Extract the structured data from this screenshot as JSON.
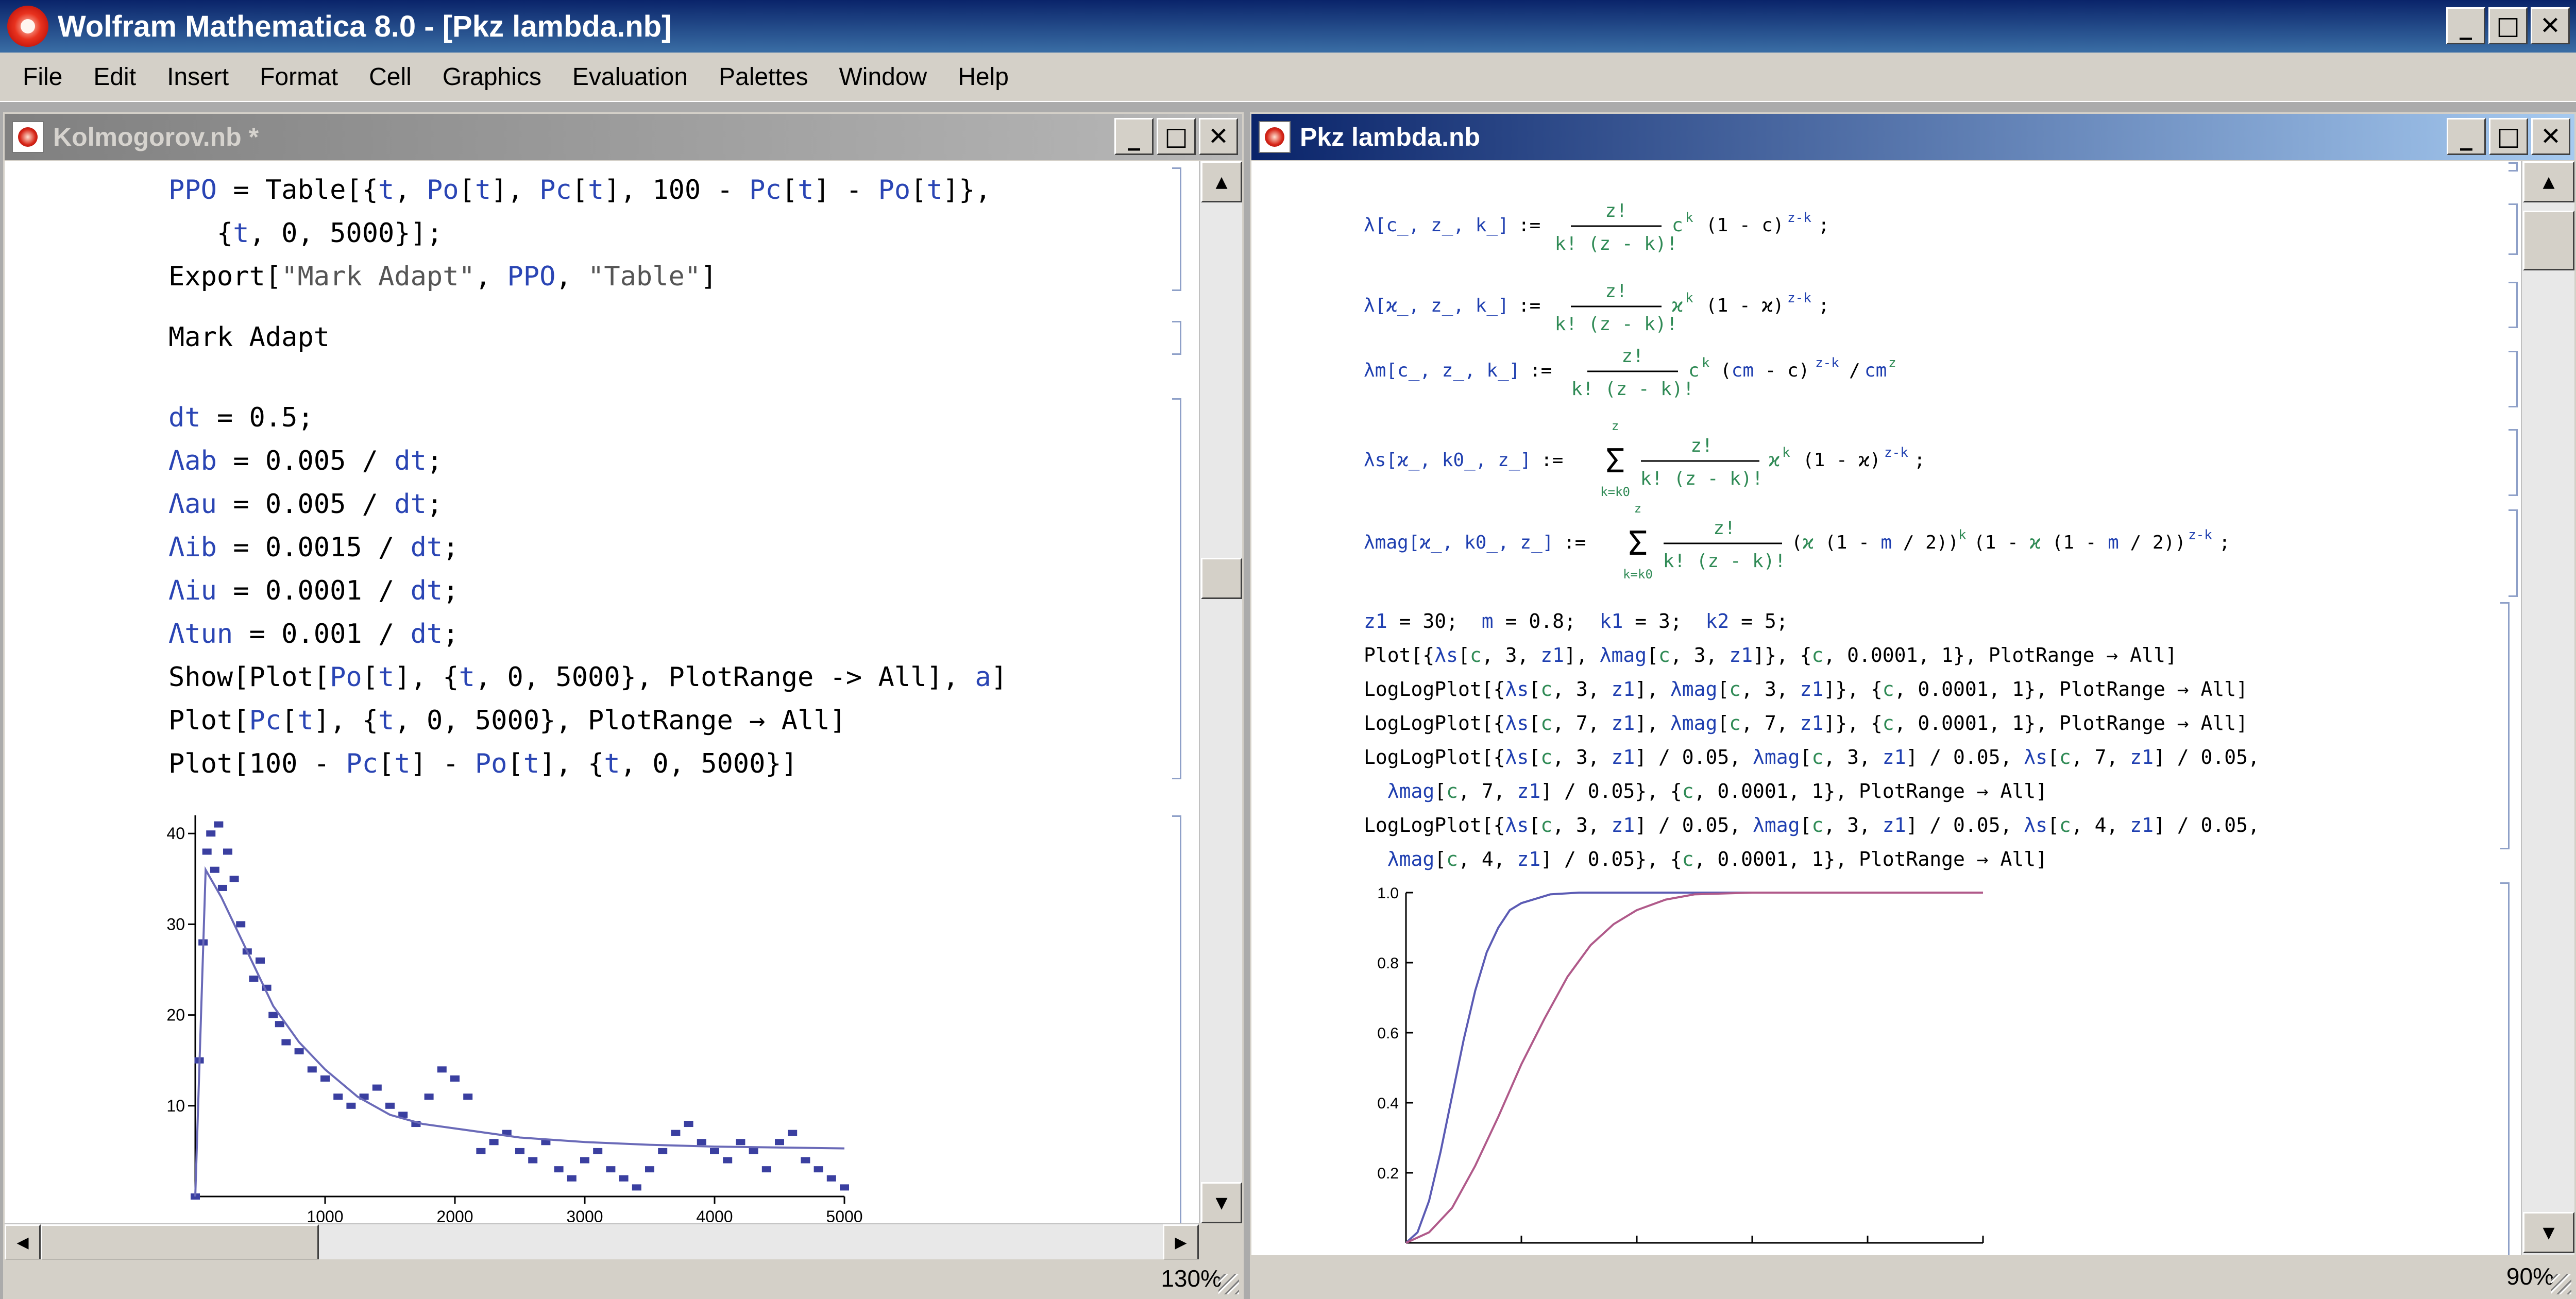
{
  "app": {
    "title": "Wolfram Mathematica 8.0 - [Pkz lambda.nb]",
    "controls": {
      "minimize": "_",
      "maximize": "□",
      "close": "✕"
    }
  },
  "menu": [
    "File",
    "Edit",
    "Insert",
    "Format",
    "Cell",
    "Graphics",
    "Evaluation",
    "Palettes",
    "Window",
    "Help"
  ],
  "left_window": {
    "title": "Kolmogorov.nb *",
    "zoom": "130%",
    "output_text": "Mark Adapt"
  },
  "right_window": {
    "title": "Pkz lambda.nb",
    "zoom": "90%"
  },
  "chart_data": [
    {
      "type": "scatter",
      "title": "",
      "xlabel": "",
      "ylabel": "",
      "xlim": [
        0,
        5000
      ],
      "ylim": [
        0,
        42
      ],
      "xticks": [
        "1000",
        "2000",
        "3000",
        "4000",
        "5000"
      ],
      "yticks": [
        "10",
        "20",
        "30",
        "40"
      ],
      "grid": false,
      "series": [
        {
          "values": [
            [
              0,
              0
            ],
            [
              30,
              15
            ],
            [
              60,
              28
            ],
            [
              90,
              38
            ],
            [
              120,
              40
            ],
            [
              150,
              36
            ],
            [
              180,
              41
            ],
            [
              210,
              34
            ],
            [
              250,
              38
            ],
            [
              300,
              35
            ],
            [
              350,
              30
            ],
            [
              400,
              27
            ],
            [
              450,
              24
            ],
            [
              500,
              26
            ],
            [
              550,
              23
            ],
            [
              600,
              20
            ],
            [
              650,
              19
            ],
            [
              700,
              17
            ],
            [
              800,
              16
            ],
            [
              900,
              14
            ],
            [
              1000,
              13
            ],
            [
              1100,
              11
            ],
            [
              1200,
              10
            ],
            [
              1300,
              11
            ],
            [
              1400,
              12
            ],
            [
              1500,
              10
            ],
            [
              1600,
              9
            ],
            [
              1700,
              8
            ],
            [
              1800,
              11
            ],
            [
              1900,
              14
            ],
            [
              2000,
              13
            ],
            [
              2100,
              11
            ],
            [
              2200,
              5
            ],
            [
              2300,
              6
            ],
            [
              2400,
              7
            ],
            [
              2500,
              5
            ],
            [
              2600,
              4
            ],
            [
              2700,
              6
            ],
            [
              2800,
              3
            ],
            [
              2900,
              2
            ],
            [
              3000,
              4
            ],
            [
              3100,
              5
            ],
            [
              3200,
              3
            ],
            [
              3300,
              2
            ],
            [
              3400,
              1
            ],
            [
              3500,
              3
            ],
            [
              3600,
              5
            ],
            [
              3700,
              7
            ],
            [
              3800,
              8
            ],
            [
              3900,
              6
            ],
            [
              4000,
              5
            ],
            [
              4100,
              4
            ],
            [
              4200,
              6
            ],
            [
              4300,
              5
            ],
            [
              4400,
              3
            ],
            [
              4500,
              6
            ],
            [
              4600,
              7
            ],
            [
              4700,
              4
            ],
            [
              4800,
              3
            ],
            [
              4900,
              2
            ],
            [
              5000,
              1
            ]
          ]
        },
        {
          "values": [
            [
              0,
              0
            ],
            [
              80,
              36
            ],
            [
              200,
              33
            ],
            [
              400,
              27
            ],
            [
              600,
              21
            ],
            [
              800,
              17
            ],
            [
              1000,
              14
            ],
            [
              1250,
              11
            ],
            [
              1500,
              9
            ],
            [
              1750,
              8
            ],
            [
              2000,
              7.5
            ],
            [
              2500,
              6.5
            ],
            [
              3000,
              6
            ],
            [
              3500,
              5.7
            ],
            [
              4000,
              5.5
            ],
            [
              4500,
              5.4
            ],
            [
              5000,
              5.3
            ]
          ]
        }
      ]
    },
    {
      "type": "line",
      "title": "",
      "xlabel": "",
      "ylabel": "",
      "xlim": [
        0,
        1
      ],
      "ylim": [
        0,
        1
      ],
      "xticks": [
        "0.2",
        "0.4",
        "0.6",
        "0.8",
        "1.0"
      ],
      "yticks": [
        "0.2",
        "0.4",
        "0.6",
        "0.8",
        "1.0"
      ],
      "colors": {
        "blue": "#5b5bb4",
        "purple": "#b05a8a"
      },
      "series": [
        {
          "values": [
            [
              0,
              0
            ],
            [
              0.02,
              0.03
            ],
            [
              0.04,
              0.12
            ],
            [
              0.06,
              0.26
            ],
            [
              0.08,
              0.42
            ],
            [
              0.1,
              0.58
            ],
            [
              0.12,
              0.72
            ],
            [
              0.14,
              0.83
            ],
            [
              0.16,
              0.9
            ],
            [
              0.18,
              0.95
            ],
            [
              0.2,
              0.97
            ],
            [
              0.25,
              0.995
            ],
            [
              0.3,
              1
            ],
            [
              1,
              1
            ]
          ]
        },
        {
          "values": [
            [
              0,
              0
            ],
            [
              0.04,
              0.03
            ],
            [
              0.08,
              0.1
            ],
            [
              0.12,
              0.22
            ],
            [
              0.16,
              0.36
            ],
            [
              0.2,
              0.51
            ],
            [
              0.24,
              0.64
            ],
            [
              0.28,
              0.76
            ],
            [
              0.32,
              0.85
            ],
            [
              0.36,
              0.91
            ],
            [
              0.4,
              0.95
            ],
            [
              0.45,
              0.98
            ],
            [
              0.5,
              0.995
            ],
            [
              0.6,
              1
            ],
            [
              1,
              1
            ]
          ]
        }
      ]
    }
  ]
}
